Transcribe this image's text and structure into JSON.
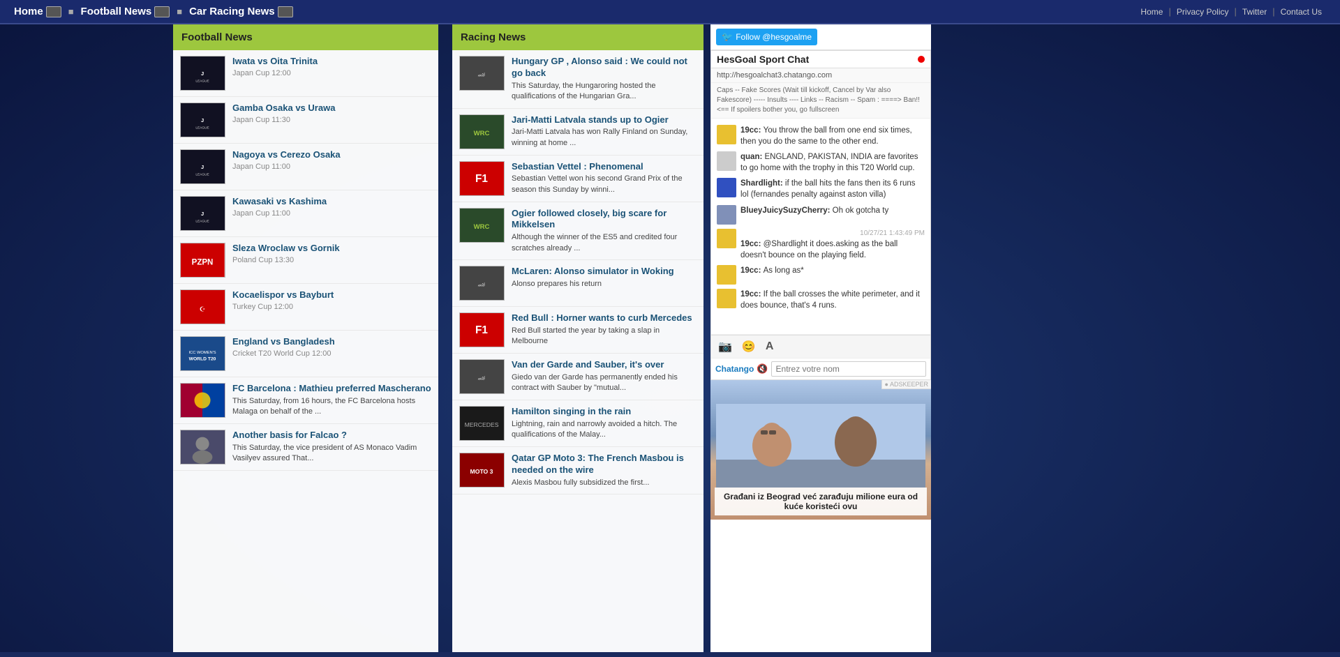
{
  "topnav": {
    "left": [
      {
        "label": "Home",
        "icon": "home-icon",
        "url": "#"
      },
      {
        "label": "Football News",
        "icon": "football-icon",
        "url": "#"
      },
      {
        "label": "Car Racing News",
        "icon": "racing-icon",
        "url": "#"
      }
    ],
    "right": [
      {
        "label": "Home",
        "url": "#"
      },
      {
        "label": "Privacy Policy",
        "url": "#"
      },
      {
        "label": "Twitter",
        "url": "#"
      },
      {
        "label": "Contact Us",
        "url": "#"
      }
    ]
  },
  "football": {
    "header": "Football News",
    "items": [
      {
        "title": "Iwata vs Oita Trinita",
        "meta": "Japan Cup 12:00",
        "desc": "",
        "thumb_class": "thumb-jleague"
      },
      {
        "title": "Gamba Osaka vs Urawa",
        "meta": "Japan Cup 11:30",
        "desc": "",
        "thumb_class": "thumb-jleague"
      },
      {
        "title": "Nagoya vs Cerezo Osaka",
        "meta": "Japan Cup 11:00",
        "desc": "",
        "thumb_class": "thumb-jleague"
      },
      {
        "title": "Kawasaki vs Kashima",
        "meta": "Japan Cup 11:00",
        "desc": "",
        "thumb_class": "thumb-jleague"
      },
      {
        "title": "Sleza Wroclaw vs Gornik",
        "meta": "Poland Cup 13:30",
        "desc": "",
        "thumb_class": "thumb-pzpn"
      },
      {
        "title": "Kocaelispor vs Bayburt",
        "meta": "Turkey Cup 12:00",
        "desc": "",
        "thumb_class": "thumb-turkiye"
      },
      {
        "title": "England vs Bangladesh",
        "meta": "Cricket T20 World Cup 12:00",
        "desc": "",
        "thumb_class": "thumb-t20"
      },
      {
        "title": "FC Barcelona : Mathieu preferred Mascherano",
        "meta": "",
        "desc": "This Saturday, from 16 hours, the FC Barcelona hosts Malaga on behalf of the ...",
        "thumb_class": "thumb-barcelona"
      },
      {
        "title": "Another basis for Falcao ?",
        "meta": "",
        "desc": "This Saturday, the vice president of AS Monaco Vadim Vasilyev assured That...",
        "thumb_class": "thumb-person"
      }
    ]
  },
  "racing": {
    "header": "Racing News",
    "items": [
      {
        "title": "Hungary GP , Alonso said : We could not go back",
        "meta": "",
        "desc": "This Saturday, the Hungaroring hosted the qualifications of the Hungarian Gra...",
        "thumb_class": "thumb-racing"
      },
      {
        "title": "Jari-Matti Latvala stands up to Ogier",
        "meta": "",
        "desc": "Jari-Matti Latvala has won Rally Finland on Sunday, winning at home ...",
        "thumb_class": "thumb-rally"
      },
      {
        "title": "Sebastian Vettel : Phenomenal",
        "meta": "",
        "desc": "Sebastian Vettel won his second Grand Prix of the season this Sunday by winni...",
        "thumb_class": "thumb-f1red"
      },
      {
        "title": "Ogier followed closely, big scare for Mikkelsen",
        "meta": "",
        "desc": "Although the winner of the ES5 and credited four scratches already ...",
        "thumb_class": "thumb-rally"
      },
      {
        "title": "McLaren: Alonso simulator in Woking",
        "meta": "",
        "desc": "Alonso prepares his return",
        "thumb_class": "thumb-racing"
      },
      {
        "title": "Red Bull : Horner wants to curb Mercedes",
        "meta": "",
        "desc": "Red Bull started the year by taking a slap in Melbourne",
        "thumb_class": "thumb-f1red"
      },
      {
        "title": "Van der Garde and Sauber, it's over",
        "meta": "",
        "desc": "Giedo van der Garde has permanently ended his contract with Sauber by \"mutual...",
        "thumb_class": "thumb-racing"
      },
      {
        "title": "Hamilton singing in the rain",
        "meta": "",
        "desc": "Lightning, rain and narrowly avoided a hitch. The qualifications of the Malay...",
        "thumb_class": "thumb-hamilton"
      },
      {
        "title": "Qatar GP Moto 3: The French Masbou is needed on the wire",
        "meta": "",
        "desc": "Alexis Masbou fully subsidized the first...",
        "thumb_class": "thumb-qatar"
      }
    ]
  },
  "chat": {
    "follow_label": "Follow @hesgoalme",
    "title": "HesGoal Sport Chat",
    "url": "http://hesgoalchat3.chatango.com",
    "rules": "Caps -- Fake Scores (Wait till kickoff, Cancel by Var also Fakescore) ----- Insults ---- Links -- Racism -- Spam : ====> Ban!! <== If spoilers bother you, go fullscreen",
    "messages": [
      {
        "user": "19cc",
        "avatar_class": "yellow",
        "text": "You throw the ball from one end six times, then you do the same to the other end.",
        "timestamp": ""
      },
      {
        "user": "quan",
        "avatar_class": "",
        "text": "ENGLAND, PAKISTAN, INDIA are favorites to go home with the trophy in this T20 World cup.",
        "timestamp": ""
      },
      {
        "user": "Shardlight",
        "avatar_class": "blue",
        "text": "if the ball hits the fans then its 6 runs lol (fernandes penalty against aston villa)",
        "timestamp": ""
      },
      {
        "user": "BlueyJuicySuzyCherry",
        "avatar_class": "img",
        "text": "Oh ok gotcha ty",
        "timestamp": ""
      },
      {
        "user": "19cc",
        "avatar_class": "yellow",
        "text": "@Shardlight it does.asking as the ball doesn't bounce on the playing field.",
        "timestamp": "10/27/21 1:43:49 PM"
      },
      {
        "user": "19cc",
        "avatar_class": "yellow",
        "text": "As long as*",
        "timestamp": ""
      },
      {
        "user": "19cc",
        "avatar_class": "yellow",
        "text": "If the ball crosses the white perimeter, and it does bounce, that's 4 runs.",
        "timestamp": ""
      }
    ],
    "chatango_label": "Chatango",
    "mute_icon": "🔇",
    "input_placeholder": "Entrez votre nom",
    "camera_icon": "📷",
    "emoji_icon": "😊",
    "text_icon": "A",
    "ad_text": "Građani iz Beograd već zarađuju milione eura od kuće koristeći ovu",
    "adskeeper": "● ADSKEEPER"
  }
}
